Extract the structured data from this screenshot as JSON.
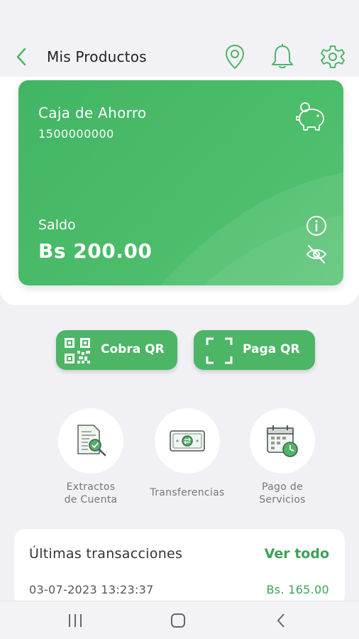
{
  "header": {
    "title": "Mis Productos",
    "icons": [
      "back-arrow-icon",
      "location-pin-icon",
      "bell-icon",
      "gear-icon"
    ]
  },
  "card": {
    "type": "Caja de Ahorro",
    "number": "1500000000",
    "balance_label": "Saldo",
    "balance": "Bs 200.00",
    "icons": [
      "piggy-bank-icon",
      "info-icon",
      "eye-off-icon"
    ]
  },
  "qr": {
    "collect_label": "Cobra QR",
    "pay_label": "Paga QR"
  },
  "actions": [
    {
      "line1": "Extractos",
      "line2": "de Cuenta",
      "icon": "statement-icon"
    },
    {
      "line1": "Transferencias",
      "line2": "",
      "icon": "money-transfer-icon"
    },
    {
      "line1": "Pago de",
      "line2": "Servicios",
      "icon": "calendar-clock-icon"
    }
  ],
  "transactions": {
    "title": "Últimas transacciones",
    "view_all": "Ver todo",
    "rows": [
      {
        "date": "03-07-2023 13:23:37",
        "amount": "Bs. 165.00"
      }
    ]
  },
  "colors": {
    "accent": "#4cb566",
    "accent_text": "#3aa356",
    "background": "#f0f0f5"
  }
}
